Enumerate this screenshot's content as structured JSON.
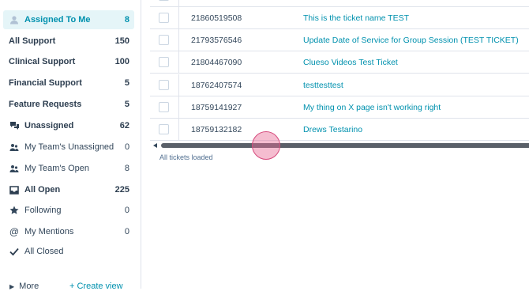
{
  "sidebar": {
    "items": [
      {
        "label": "Assigned To Me",
        "count": "8",
        "icon": "user-icon"
      },
      {
        "label": "All Support",
        "count": "150"
      },
      {
        "label": "Clinical Support",
        "count": "100"
      },
      {
        "label": "Financial Support",
        "count": "5"
      },
      {
        "label": "Feature Requests",
        "count": "5"
      },
      {
        "label": "Unassigned",
        "count": "62",
        "icon": "chat-bubbles-icon"
      },
      {
        "label": "My Team's Unassigned",
        "count": "0",
        "icon": "team-icon"
      },
      {
        "label": "My Team's Open",
        "count": "8",
        "icon": "team-icon"
      },
      {
        "label": "All Open",
        "count": "225",
        "icon": "inbox-icon"
      },
      {
        "label": "Following",
        "count": "0",
        "icon": "star-icon"
      },
      {
        "label": "My Mentions",
        "count": "0",
        "icon": "at-icon"
      },
      {
        "label": "All Closed",
        "count": "",
        "icon": "check-icon"
      }
    ],
    "more_label": "More",
    "create_view_label": "+ Create view"
  },
  "table": {
    "rows": [
      {
        "id": "21860519508",
        "name": "This is the ticket name TEST"
      },
      {
        "id": "21793576546",
        "name": "Update Date of Service for Group Session (TEST TICKET)"
      },
      {
        "id": "21804467090",
        "name": "Clueso Videos Test Ticket"
      },
      {
        "id": "18762407574",
        "name": "testtesttest"
      },
      {
        "id": "18759141927",
        "name": "My thing on X page isn't working right"
      },
      {
        "id": "18759132182",
        "name": "Drews Testarino"
      }
    ],
    "status_text": "All tickets loaded"
  },
  "colors": {
    "accent": "#0091ae",
    "selected_bg": "#e5f5f8",
    "text": "#33475b",
    "cursor": "#e86c96"
  }
}
